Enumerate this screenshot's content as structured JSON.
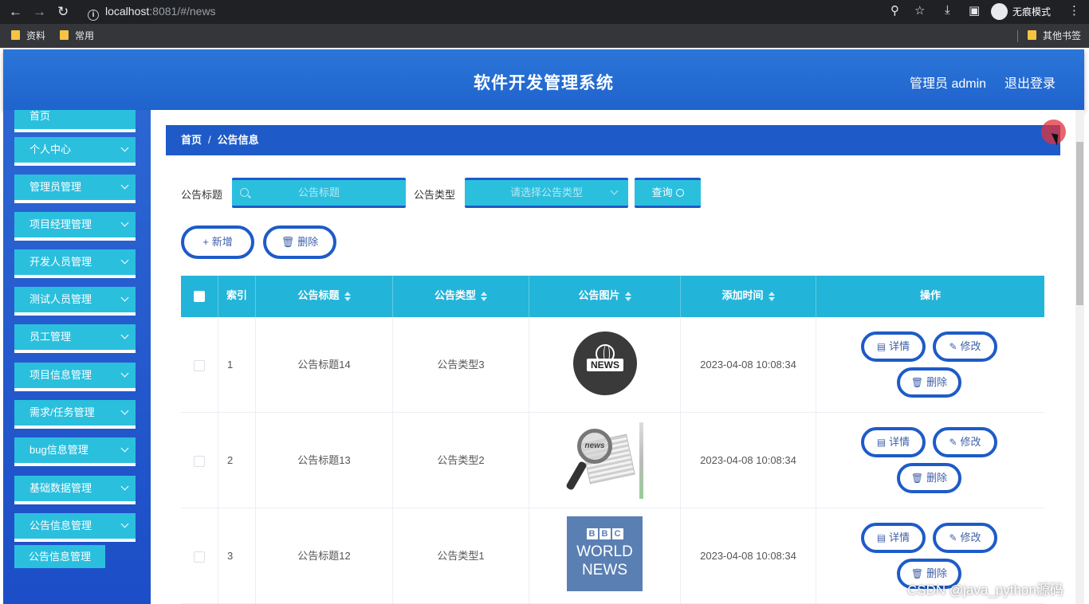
{
  "browser": {
    "url_host": "localhost",
    "url_path": ":8081/#/news",
    "incognito_label": "无痕模式",
    "bookmarks": [
      "资料",
      "常用"
    ],
    "other_bookmarks": "其他书签"
  },
  "header": {
    "title": "软件开发管理系统",
    "admin_label": "管理员 admin",
    "logout_label": "退出登录"
  },
  "sidebar": {
    "items": [
      {
        "label": "首页"
      },
      {
        "label": "个人中心"
      },
      {
        "label": "管理员管理"
      },
      {
        "label": "项目经理管理"
      },
      {
        "label": "开发人员管理"
      },
      {
        "label": "测试人员管理"
      },
      {
        "label": "员工管理"
      },
      {
        "label": "项目信息管理"
      },
      {
        "label": "需求/任务管理"
      },
      {
        "label": "bug信息管理"
      },
      {
        "label": "基础数据管理"
      },
      {
        "label": "公告信息管理"
      }
    ],
    "active_sub": "公告信息管理"
  },
  "breadcrumb": {
    "home": "首页",
    "sep": "/",
    "current": "公告信息"
  },
  "search": {
    "title_label": "公告标题",
    "title_placeholder": "公告标题",
    "type_label": "公告类型",
    "type_placeholder": "请选择公告类型",
    "query_label": "查询"
  },
  "actions": {
    "add_label": "新增",
    "delete_label": "删除"
  },
  "table": {
    "headers": {
      "index": "索引",
      "title": "公告标题",
      "type": "公告类型",
      "image": "公告图片",
      "time": "添加时间",
      "ops": "操作"
    },
    "rows": [
      {
        "index": "1",
        "title": "公告标题14",
        "type": "公告类型3",
        "time": "2023-04-08 10:08:34",
        "image": "news-globe-icon"
      },
      {
        "index": "2",
        "title": "公告标题13",
        "type": "公告类型2",
        "time": "2023-04-08 10:08:34",
        "image": "newspaper-magnifier"
      },
      {
        "index": "3",
        "title": "公告标题12",
        "type": "公告类型1",
        "time": "2023-04-08 10:08:34",
        "image": "bbc-world-news"
      }
    ],
    "row_actions": {
      "detail": "详情",
      "edit": "修改",
      "delete": "删除"
    }
  },
  "image_text": {
    "news": "NEWS",
    "bbc": [
      "B",
      "B",
      "C"
    ],
    "world": "WORLD",
    "news2": "NEWS",
    "lens": "news"
  },
  "watermark": "CSDN @java_python源码",
  "colors": {
    "header_blue": "#1f63cc",
    "cyan": "#2bbfde",
    "table_head": "#23b4d9"
  }
}
